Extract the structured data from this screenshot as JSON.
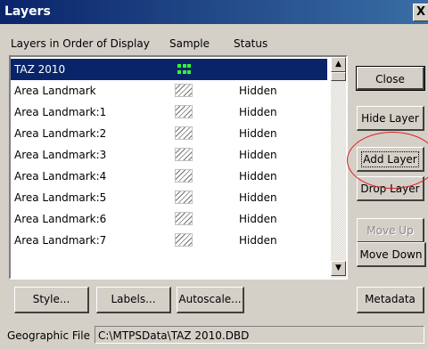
{
  "dialog": {
    "title": "Layers",
    "close_glyph": "X"
  },
  "columns": {
    "name": "Layers in Order of Display",
    "sample": "Sample",
    "status": "Status"
  },
  "layers": [
    {
      "name": "TAZ 2010",
      "sample": "green-dots",
      "status": "",
      "selected": true
    },
    {
      "name": "Area Landmark",
      "sample": "hatch",
      "status": "Hidden"
    },
    {
      "name": "Area Landmark:1",
      "sample": "hatch",
      "status": "Hidden"
    },
    {
      "name": "Area Landmark:2",
      "sample": "hatch",
      "status": "Hidden"
    },
    {
      "name": "Area Landmark:3",
      "sample": "hatch",
      "status": "Hidden"
    },
    {
      "name": "Area Landmark:4",
      "sample": "hatch",
      "status": "Hidden"
    },
    {
      "name": "Area Landmark:5",
      "sample": "hatch",
      "status": "Hidden"
    },
    {
      "name": "Area Landmark:6",
      "sample": "hatch",
      "status": "Hidden"
    },
    {
      "name": "Area Landmark:7",
      "sample": "hatch",
      "status": "Hidden"
    }
  ],
  "buttons": {
    "close": "Close",
    "hide_layer": "Hide Layer",
    "add_layer": "Add Layer",
    "drop_layer": "Drop Layer",
    "move_up": "Move Up",
    "move_down": "Move Down",
    "metadata": "Metadata",
    "style": "Style...",
    "labels": "Labels...",
    "autoscale": "Autoscale..."
  },
  "scroll_glyphs": {
    "up": "▲",
    "down": "▼"
  },
  "geographic_file": {
    "label": "Geographic File",
    "value": "C:\\MTPSData\\TAZ 2010.DBD"
  },
  "colors": {
    "titlebar": "#0a246a",
    "selection": "#0a246a",
    "highlight_oval": "#e02020",
    "sample_dots": "#30ff30"
  }
}
